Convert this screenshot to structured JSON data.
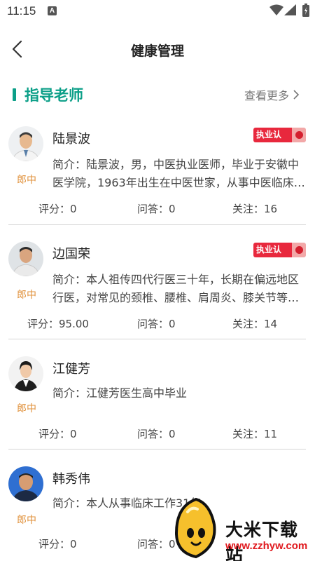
{
  "status_bar": {
    "time": "11:15",
    "notification_icon": "A"
  },
  "nav": {
    "title": "健康管理"
  },
  "section": {
    "title": "指导老师",
    "see_more": "查看更多"
  },
  "badge_label": "执业认证",
  "doctors": [
    {
      "name": "陆景波",
      "title": "郎中",
      "intro": "简介：陆景波，男，中医执业医师，毕业于安徽中医学院，1963年出生在中医世家，从事中医临床工作",
      "rating": "评分：0",
      "answers": "问答：0",
      "follows": "关注：16",
      "certified": true
    },
    {
      "name": "边国荣",
      "title": "郎中",
      "intro": "简介：本人祖传四代行医三十年，长期在偏远地区行医，对常见的颈椎、腰椎、肩周炎、膝关节等疾病有丰富经验",
      "rating": "评分：95.00",
      "answers": "问答：0",
      "follows": "关注：14",
      "certified": true
    },
    {
      "name": "江健芳",
      "title": "郎中",
      "intro": "简介：江健芳医生高中毕业",
      "rating": "评分：0",
      "answers": "问答：0",
      "follows": "关注：11",
      "certified": false
    },
    {
      "name": "韩秀伟",
      "title": "郎中",
      "intro": "简介：本人从事临床工作31年",
      "rating": "评分：0",
      "answers": "问答：0",
      "follows": "",
      "certified": false
    }
  ],
  "watermark": {
    "text": "大米下载站",
    "url": "www.zzhyw.com"
  },
  "colors": {
    "accent": "#0c9f88",
    "title_label": "#e0913b",
    "badge": "#e8283d"
  }
}
